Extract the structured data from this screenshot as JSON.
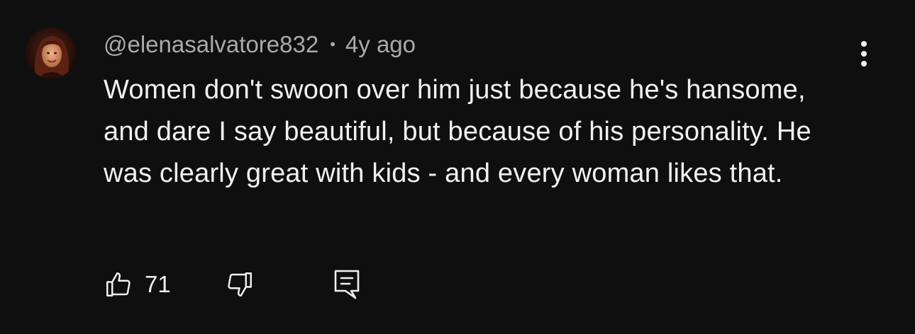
{
  "comment": {
    "avatar_icon": "user-avatar-photo",
    "author": "@elenasalvatore832",
    "separator": "•",
    "timestamp": "4y ago",
    "text": "Women don't swoon over him just because he's hansome, and dare I say beautiful, but because of his personality. He was clearly great with kids - and every woman likes that.",
    "more_icon": "more-vertical-icon",
    "actions": {
      "like_icon": "thumbs-up-icon",
      "like_count": "71",
      "dislike_icon": "thumbs-down-icon",
      "reply_icon": "reply-comment-icon"
    }
  },
  "colors": {
    "background": "#0f0f0f",
    "primary_text": "#f1f1f1",
    "secondary_text": "#aaaaaa"
  }
}
